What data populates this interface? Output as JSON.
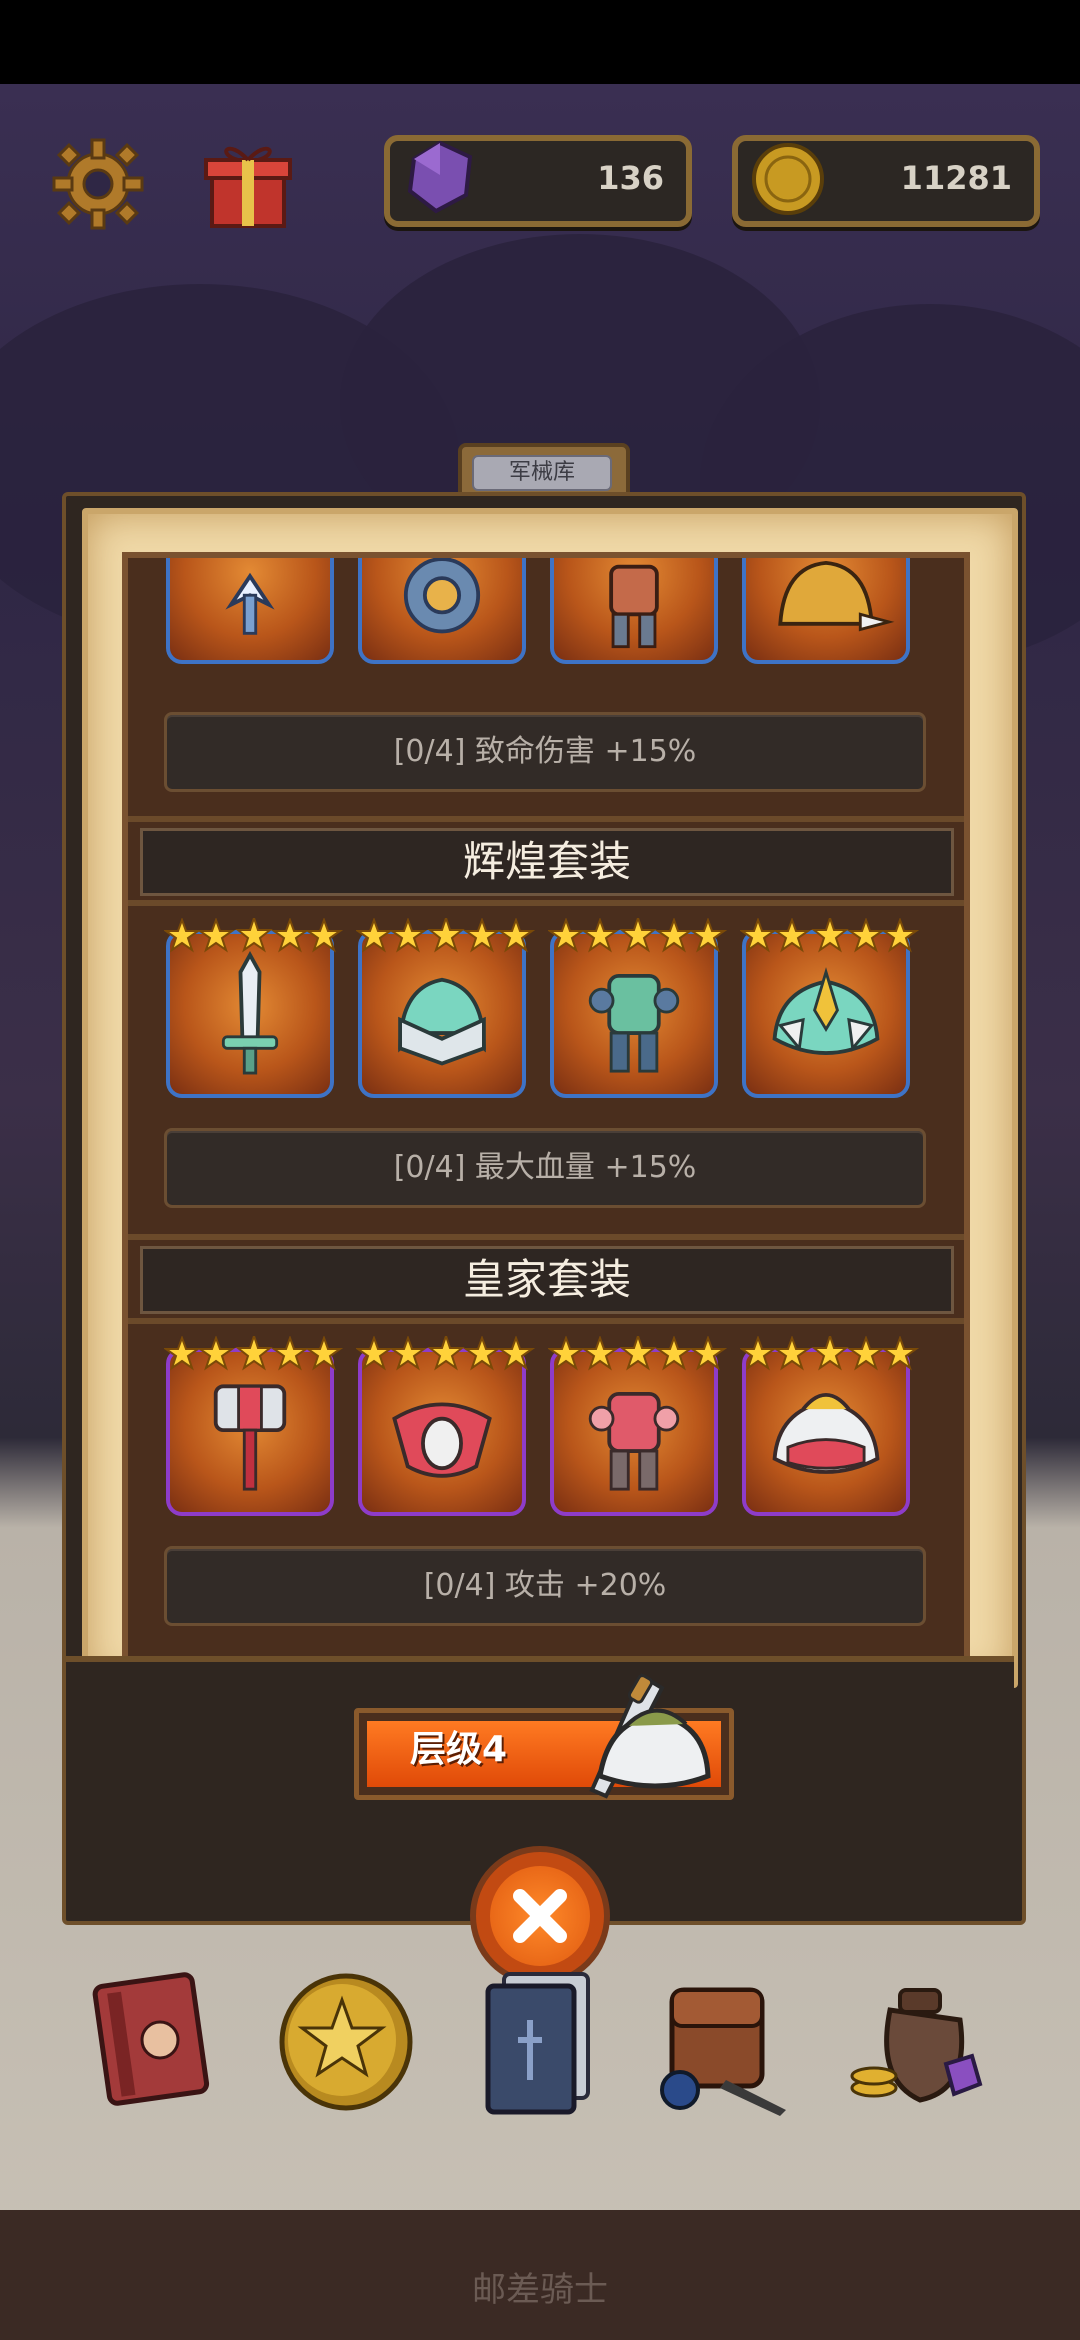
{
  "top_bar": {
    "settings_icon": "gear-icon",
    "gift_icon": "gift-icon",
    "gems": "136",
    "coins": "11281"
  },
  "panel": {
    "tab_label": "军械库",
    "sets": [
      {
        "title": "",
        "stars": 0,
        "items": [
          "scepter",
          "shield-amulet",
          "armor",
          "helmet"
        ],
        "bonus": "[0/4] 致命伤害 +15%"
      },
      {
        "title": "辉煌套装",
        "stars": 5,
        "items": [
          "sword",
          "helmet",
          "armor",
          "crown-helmet"
        ],
        "bonus": "[0/4] 最大血量 +15%"
      },
      {
        "title": "皇家套装",
        "stars": 5,
        "items": [
          "hammer",
          "shield-helmet",
          "armor",
          "helmet"
        ],
        "bonus": "[0/4] 攻击 +20%"
      }
    ],
    "level_label": "层级4"
  },
  "bottom_nav": [
    "book-icon",
    "star-coin-icon",
    "card-deck-icon",
    "backpack-icon",
    "treasure-bag-icon"
  ],
  "app_name": "邮差骑士",
  "colors": {
    "panel_dark": "#4a2e1d",
    "blue_frame": "#3e73c6",
    "purple_frame": "#8e3cc9",
    "orange": "#e04a08"
  }
}
